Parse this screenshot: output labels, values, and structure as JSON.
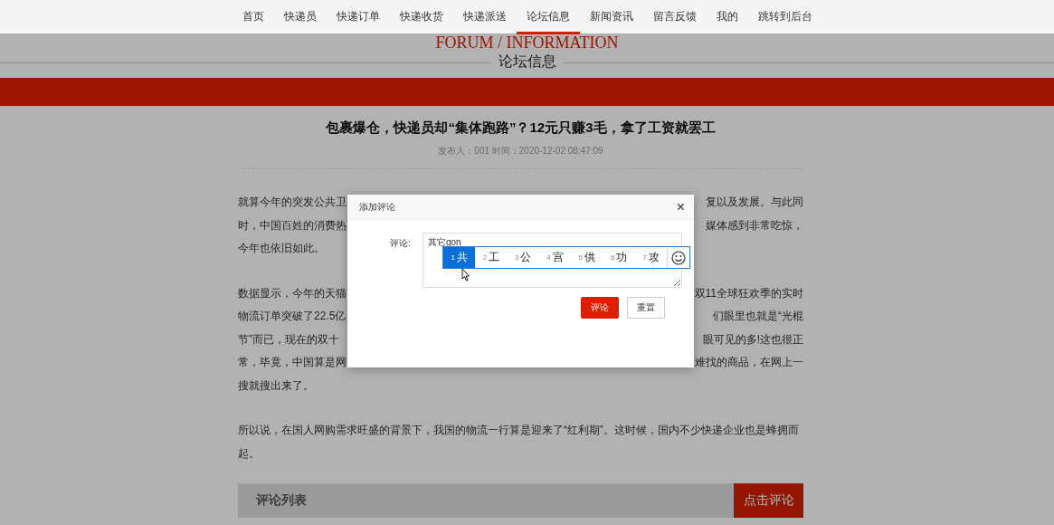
{
  "nav": [
    {
      "label": "首页",
      "selected": false
    },
    {
      "label": "快递员",
      "selected": false
    },
    {
      "label": "快递订单",
      "selected": false
    },
    {
      "label": "快递收货",
      "selected": false
    },
    {
      "label": "快递派送",
      "selected": false
    },
    {
      "label": "论坛信息",
      "selected": true
    },
    {
      "label": "新闻资讯",
      "selected": false
    },
    {
      "label": "留言反馈",
      "selected": false
    },
    {
      "label": "我的",
      "selected": false
    },
    {
      "label": "跳转到后台",
      "selected": false
    }
  ],
  "header": {
    "title_en": "FORUM / INFORMATION",
    "title": "论坛信息"
  },
  "article": {
    "title": "包裹爆仓，快递员却“集体跑路”？12元只赚3毛，拿了工资就罢工",
    "meta": "发布人：001 时间：2020-12-02 08:47:09",
    "paragraphs": [
      {
        "lines": [
          {
            "left": "就算今年的突发公共卫",
            "right": "复以及发展。与此同"
          },
          {
            "left": "时，中国百姓的消费热",
            "right": "媒体感到非常吃惊，"
          },
          {
            "left": "今年也依旧如此。"
          }
        ]
      },
      {
        "lines": [
          {
            "left": "数据显示，今年的天猫",
            "right": "双11全球狂欢季的实时"
          },
          {
            "left": "物流订单突破了22.5亿",
            "right": "们眼里也就是“光棍"
          },
          {
            "left": "节”而已，现在的双十",
            "right": "眼可见的多!这也很正"
          },
          {
            "left": "常，毕竟，中国算是网",
            "right": "难找的商品，在网上一"
          },
          {
            "left": "搜就搜出来了。"
          }
        ]
      },
      {
        "lines": [
          {
            "left": "所以说，在国人网购需求旺盛的背景下，我国的物流一行算是迎来了“红利期”。这时候，国内不少快递企业也是蜂拥而起。"
          }
        ]
      }
    ]
  },
  "comments": {
    "title": "评论列表",
    "button": "点击评论"
  },
  "dialog": {
    "title": "添加评论",
    "close": "×",
    "label": "评论:",
    "value": "其它gon",
    "candidates": [
      {
        "index": "1",
        "text": "共",
        "selected": true
      },
      {
        "index": "2",
        "text": "工",
        "selected": false
      },
      {
        "index": "3",
        "text": "公",
        "selected": false
      },
      {
        "index": "4",
        "text": "宫",
        "selected": false
      },
      {
        "index": "5",
        "text": "供",
        "selected": false
      },
      {
        "index": "6",
        "text": "功",
        "selected": false
      },
      {
        "index": "7",
        "text": "攻",
        "selected": false
      }
    ],
    "buttons": [
      {
        "label": "评论",
        "kind": "primary"
      },
      {
        "label": "重置",
        "kind": "default"
      }
    ]
  }
}
